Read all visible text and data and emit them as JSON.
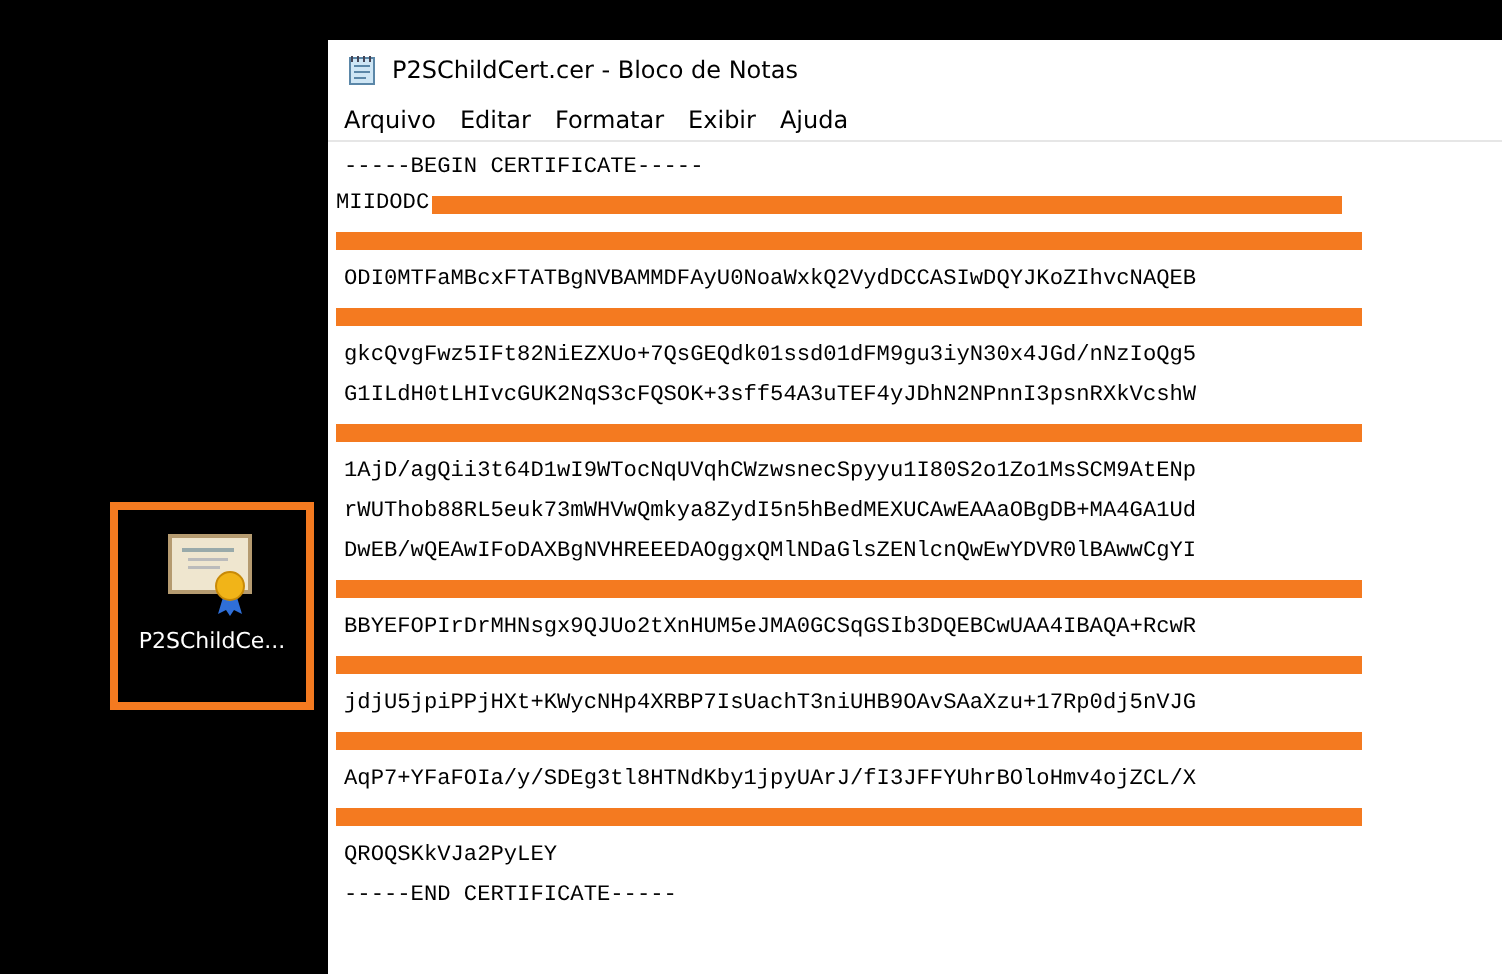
{
  "desktop_icon": {
    "label": "P2SChildCe...",
    "selected": true
  },
  "window": {
    "title": "P2SChildCert.cer - Bloco de Notas"
  },
  "menu": [
    "Arquivo",
    "Editar",
    "Formatar",
    "Exibir",
    "Ajuda"
  ],
  "lines": [
    {
      "kind": "text",
      "text": "-----BEGIN CERTIFICATE-----"
    },
    {
      "kind": "partial",
      "text": "MIIDODC"
    },
    {
      "kind": "redacted"
    },
    {
      "kind": "text",
      "text": "ODI0MTFaMBcxFTATBgNVBAMMDFAyU0NoaWxkQ2VydDCCASIwDQYJKoZIhvcNAQEB"
    },
    {
      "kind": "redacted"
    },
    {
      "kind": "text",
      "text": "gkcQvgFwz5IFt82NiEZXUo+7QsGEQdk01ssd01dFM9gu3iyN30x4JGd/nNzIoQg5"
    },
    {
      "kind": "text",
      "text": "G1ILdH0tLHIvcGUK2NqS3cFQSOK+3sff54A3uTEF4yJDhN2NPnnI3psnRXkVcshW"
    },
    {
      "kind": "redacted"
    },
    {
      "kind": "text",
      "text": "1AjD/agQii3t64D1wI9WTocNqUVqhCWzwsnecSpyyu1I80S2o1Zo1MsSCM9AtENp"
    },
    {
      "kind": "text",
      "text": "rWUThob88RL5euk73mWHVwQmkya8ZydI5n5hBedMEXUCAwEAAaOBgDB+MA4GA1Ud"
    },
    {
      "kind": "text",
      "text": "DwEB/wQEAwIFoDAXBgNVHREEEDAOggxQMlNDaGlsZENlcnQwEwYDVR0lBAwwCgYI"
    },
    {
      "kind": "redacted"
    },
    {
      "kind": "text",
      "text": "BBYEFOPIrDrMHNsgx9QJUo2tXnHUM5eJMA0GCSqGSIb3DQEBCwUAA4IBAQA+RcwR"
    },
    {
      "kind": "redacted"
    },
    {
      "kind": "text",
      "text": "jdjU5jpiPPjHXt+KWycNHp4XRBP7IsUachT3niUHB9OAvSAaXzu+17Rp0dj5nVJG"
    },
    {
      "kind": "redacted"
    },
    {
      "kind": "text",
      "text": "AqP7+YFaFOIa/y/SDEg3tl8HTNdKby1jpyUArJ/fI3JFFYUhrBOloHmv4ojZCL/X"
    },
    {
      "kind": "redacted"
    },
    {
      "kind": "text",
      "text": "QROQSKkVJa2PyLEY"
    },
    {
      "kind": "text",
      "text": "-----END CERTIFICATE-----"
    }
  ]
}
